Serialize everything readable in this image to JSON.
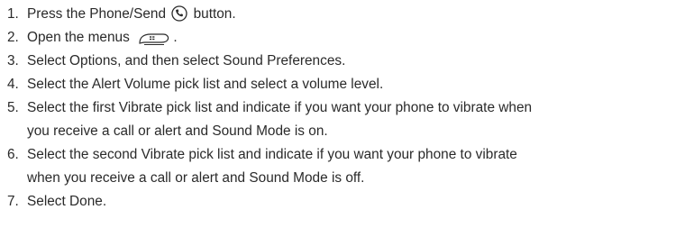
{
  "steps": [
    {
      "number": "1.",
      "before_icon": "Press the Phone/Send",
      "icon": "phone-icon",
      "after_icon": " button."
    },
    {
      "number": "2.",
      "before_icon": "Open the menus",
      "icon": "menu-icon",
      "after_icon": "."
    },
    {
      "number": "3.",
      "text": "Select Options, and then select Sound Preferences."
    },
    {
      "number": "4.",
      "text": "Select the Alert Volume pick list and select a volume level."
    },
    {
      "number": "5.",
      "line1": "Select the first Vibrate pick list and indicate if you want your phone to vibrate when",
      "line2": "you receive a call or alert and Sound Mode is on."
    },
    {
      "number": "6.",
      "line1": "Select the second Vibrate pick list and indicate if you want your phone to vibrate",
      "line2": "when you receive a call or alert and Sound Mode is off."
    },
    {
      "number": "7.",
      "text": "Select Done."
    }
  ]
}
